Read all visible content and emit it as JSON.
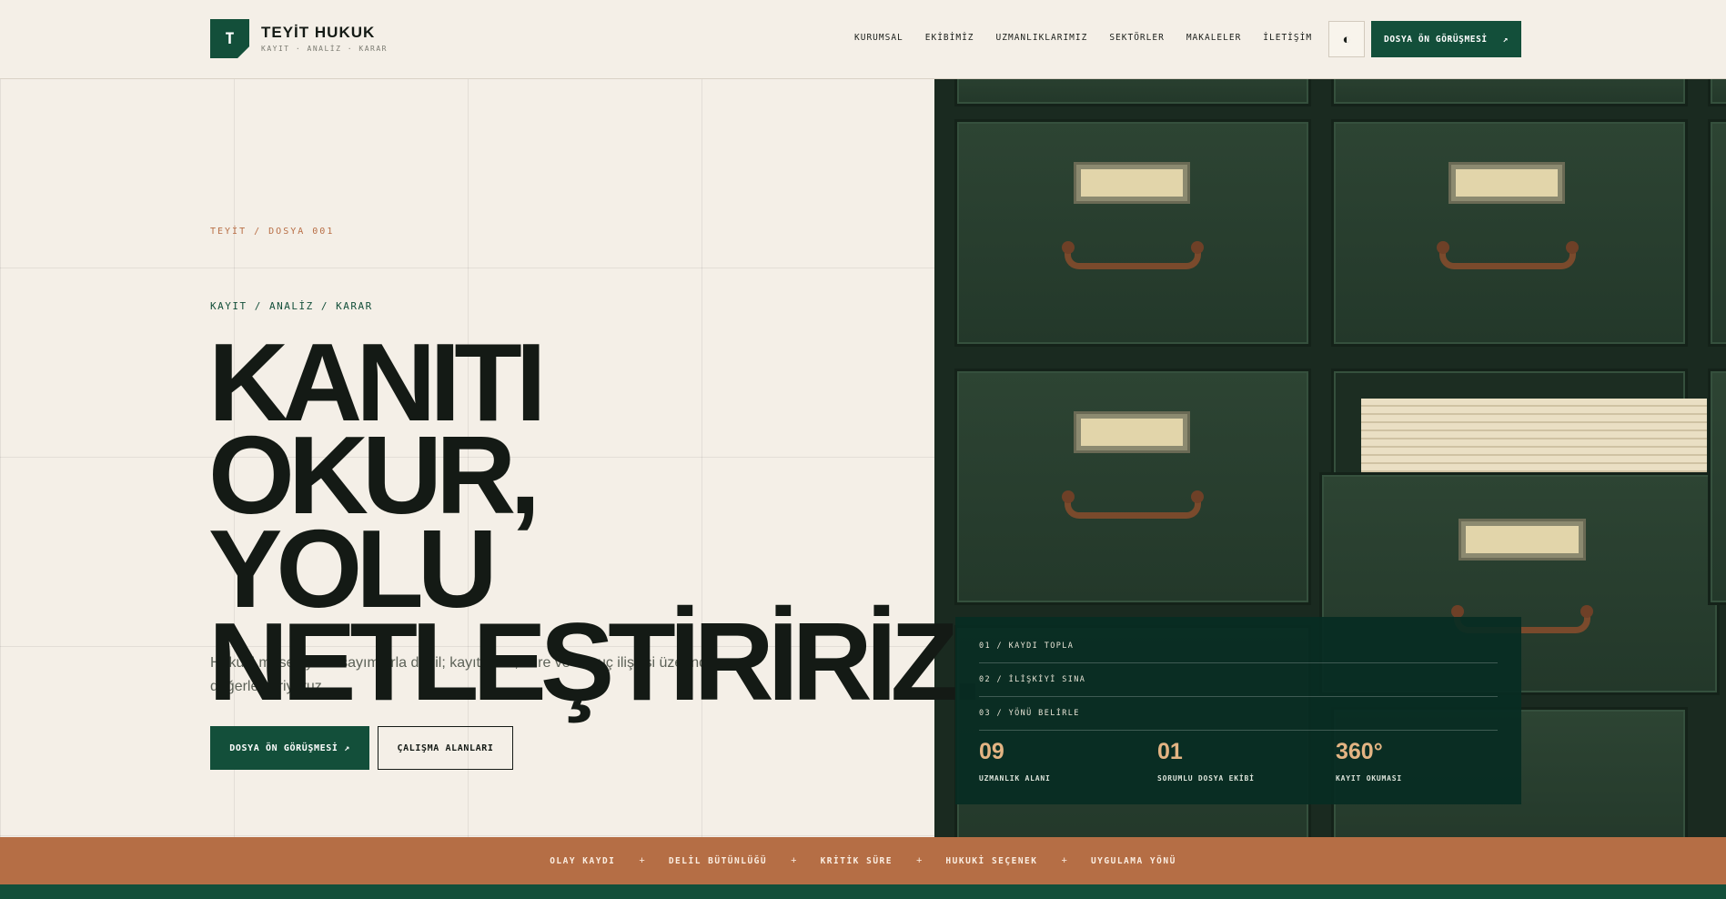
{
  "brand": {
    "mark": "T",
    "name": "TEYİT HUKUK",
    "tagline": "KAYIT · ANALİZ · KARAR"
  },
  "nav": {
    "items": [
      "KURUMSAL",
      "EKİBİMİZ",
      "UZMANLIKLARIMIZ",
      "SEKTÖRLER",
      "MAKALELER",
      "İLETİŞİM"
    ],
    "theme_icon": "◐",
    "cta": "DOSYA ÖN GÖRÜŞMESİ",
    "cta_icon": "↗"
  },
  "hero": {
    "kicker": "TEYİT / DOSYA 001",
    "subkicker": "KAYIT / ANALİZ / KARAR",
    "headline": [
      "KANITI",
      "OKUR,",
      "YOLU",
      "NETLEŞTİRİRİZ."
    ],
    "lede": "Hukuki meseleyi varsayımlarla değil; kayıt, delil, süre ve sonuç ilişkisi üzerinden değerlendiriyoruz.",
    "primary_button": "DOSYA ÖN GÖRÜŞMESİ ↗",
    "secondary_button": "ÇALIŞMA ALANLARI"
  },
  "panel": {
    "steps": [
      "01 / KAYDI TOPLA",
      "02 / İLİŞKİYİ SINA",
      "03 / YÖNÜ BELİRLE"
    ],
    "stats": [
      {
        "value": "09",
        "label": "UZMANLIK ALANI"
      },
      {
        "value": "01",
        "label": "SORUMLU DOSYA EKİBİ"
      },
      {
        "value": "360°",
        "label": "KAYIT OKUMASI"
      }
    ]
  },
  "ticker": {
    "items": [
      "OLAY KAYDI",
      "DELİL BÜTÜNLÜĞÜ",
      "KRİTİK SÜRE",
      "HUKUKİ SEÇENEK",
      "UYGULAMA YÖNÜ"
    ],
    "separator": "+"
  },
  "colors": {
    "background": "#f4efe7",
    "primary_green": "#134f3a",
    "accent_copper": "#b56e45",
    "stat_number": "#e3b483",
    "text_dark": "#141a15"
  },
  "icons": {
    "theme_toggle": "half-circle-icon",
    "cta_arrow": "arrow-up-right-icon"
  }
}
